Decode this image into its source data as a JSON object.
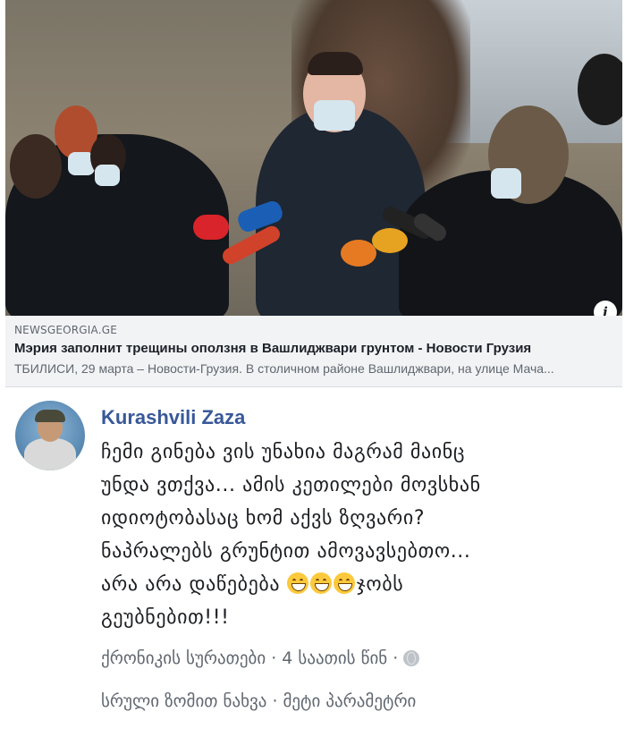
{
  "link_preview": {
    "domain": "NEWSGEORGIA.GE",
    "headline": "Мэрия заполнит трещины оползня в Вашлиджвари грунтом - Новости Грузия",
    "description": "ТБИЛИСИ, 29 марта – Новости-Грузия. В столичном районе Вашлиджвари, на улице Мача...",
    "info_glyph": "i"
  },
  "comment": {
    "author": "Kurashvili Zaza",
    "text_lines": [
      "ჩემი გინება ვის უნახია მაგრამ მაინც",
      "უნდა ვთქვა... ამის კეთილები მოვსხან",
      "იდიოტობასაც ხომ აქვს ზღვარი?",
      "ნაპრალებს გრუნტით ამოვავსებთო...",
      "არა არა დაწებება",
      "ჯობს",
      "გეუბნებით!!!"
    ],
    "emoji_count": 3,
    "emoji_name": "grinning-face-with-smiling-eyes"
  },
  "meta": {
    "source": "ქრონიკის სურათები",
    "separator": "·",
    "time": "4 საათის წინ",
    "privacy_icon": "globe-icon"
  },
  "actions": {
    "view_full": "სრული ზომით ნახვა",
    "separator": "·",
    "more_options": "მეტი პარამეტრი"
  }
}
